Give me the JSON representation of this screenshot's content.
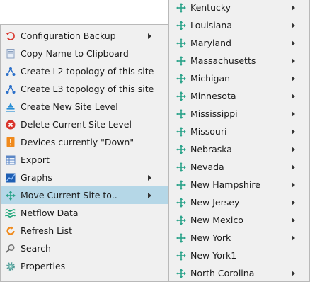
{
  "context_menu": {
    "items": [
      {
        "label": "Configuration Backup",
        "icon": "configuration-backup-icon",
        "submenu": true
      },
      {
        "label": "Copy Name to Clipboard",
        "icon": "clipboard-icon",
        "submenu": false
      },
      {
        "label": "Create L2 topology of this site",
        "icon": "topology-icon",
        "submenu": false
      },
      {
        "label": "Create L3 topology of this site",
        "icon": "topology-icon",
        "submenu": false
      },
      {
        "label": "Create New Site Level",
        "icon": "site-level-icon",
        "submenu": false
      },
      {
        "label": "Delete Current Site Level",
        "icon": "delete-icon",
        "submenu": false
      },
      {
        "label": "Devices currently \"Down\"",
        "icon": "alert-icon",
        "submenu": false
      },
      {
        "label": "Export",
        "icon": "export-table-icon",
        "submenu": false
      },
      {
        "label": "Graphs",
        "icon": "graph-icon",
        "submenu": true
      },
      {
        "label": "Move Current Site to..",
        "icon": "move-icon",
        "submenu": true,
        "selected": true
      },
      {
        "label": "Netflow Data",
        "icon": "netflow-icon",
        "submenu": false
      },
      {
        "label": "Refresh List",
        "icon": "refresh-icon",
        "submenu": false
      },
      {
        "label": "Search",
        "icon": "search-icon",
        "submenu": false
      },
      {
        "label": "Properties",
        "icon": "gear-icon",
        "submenu": false
      }
    ]
  },
  "submenu": {
    "items": [
      {
        "label": "Kentucky",
        "icon": "move-icon",
        "submenu": true
      },
      {
        "label": "Louisiana",
        "icon": "move-icon",
        "submenu": true
      },
      {
        "label": "Maryland",
        "icon": "move-icon",
        "submenu": true
      },
      {
        "label": "Massachusetts",
        "icon": "move-icon",
        "submenu": true
      },
      {
        "label": "Michigan",
        "icon": "move-icon",
        "submenu": true
      },
      {
        "label": "Minnesota",
        "icon": "move-icon",
        "submenu": true
      },
      {
        "label": "Mississippi",
        "icon": "move-icon",
        "submenu": true
      },
      {
        "label": "Missouri",
        "icon": "move-icon",
        "submenu": true
      },
      {
        "label": "Nebraska",
        "icon": "move-icon",
        "submenu": true
      },
      {
        "label": "Nevada",
        "icon": "move-icon",
        "submenu": true
      },
      {
        "label": "New Hampshire",
        "icon": "move-icon",
        "submenu": true
      },
      {
        "label": "New Jersey",
        "icon": "move-icon",
        "submenu": true
      },
      {
        "label": "New Mexico",
        "icon": "move-icon",
        "submenu": true
      },
      {
        "label": "New York",
        "icon": "move-icon",
        "submenu": true
      },
      {
        "label": "New York1",
        "icon": "move-icon",
        "submenu": false
      },
      {
        "label": "North Corolina",
        "icon": "move-icon",
        "submenu": true
      }
    ]
  },
  "colors": {
    "menu_bg": "#f0f0f0",
    "selected_bg": "#b5d7e7",
    "move_icon": "#2aa38a",
    "delete_icon": "#d9342b",
    "alert_icon": "#f08a1c",
    "topology_icon": "#2a6fc9"
  }
}
